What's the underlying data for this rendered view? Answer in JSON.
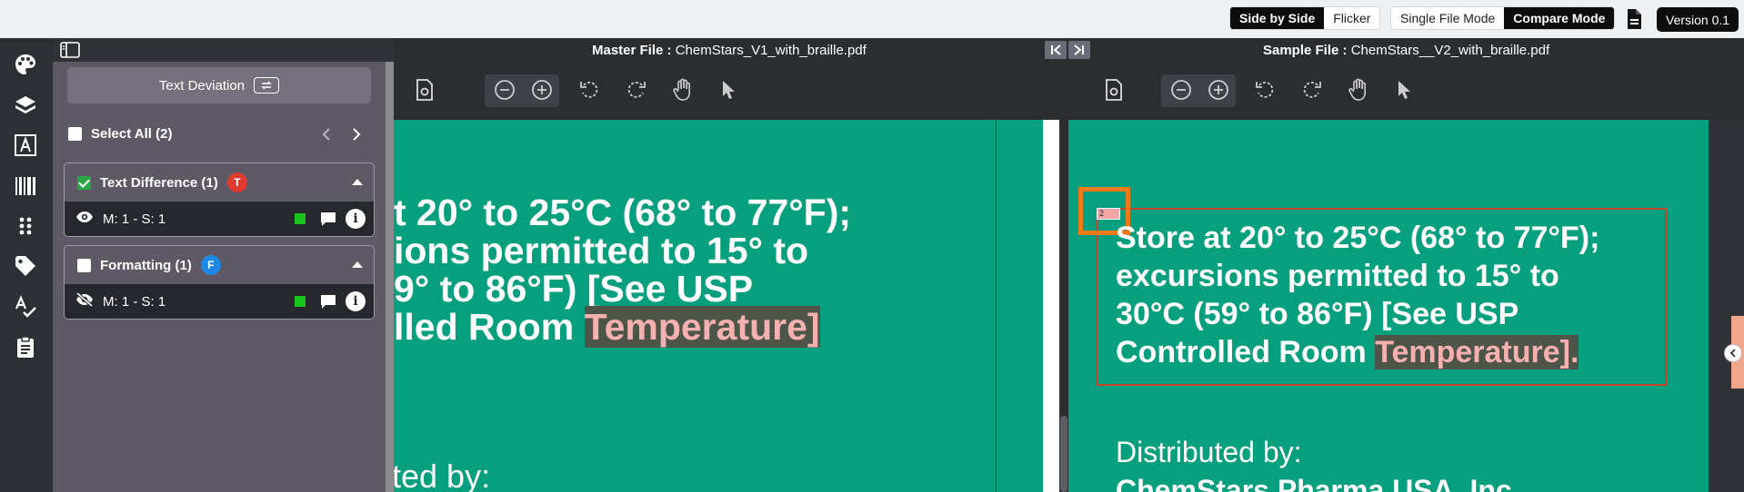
{
  "topbar": {
    "view_modes": [
      "Side by Side",
      "Flicker"
    ],
    "active_view_mode": "Side by Side",
    "file_modes": [
      "Single File Mode",
      "Compare Mode"
    ],
    "active_file_mode": "Compare Mode",
    "version": "Version 0.1"
  },
  "rail": {
    "icons": [
      "palette-icon",
      "layers-icon",
      "text-a-icon",
      "barcode-icon",
      "grid-dots-icon",
      "tag-icon",
      "spellcheck-icon",
      "clipboard-icon"
    ]
  },
  "panel": {
    "text_deviation_label": "Text Deviation",
    "select_all_label": "Select All (2)",
    "groups": [
      {
        "title": "Text Difference (1)",
        "checked": true,
        "badge": "T",
        "badge_color": "#e03a2f",
        "rows": [
          {
            "label": "M: 1 - S: 1",
            "visibility_icon": "eye-icon"
          }
        ]
      },
      {
        "title": "Formatting (1)",
        "checked": false,
        "badge": "F",
        "badge_color": "#1e88e5",
        "rows": [
          {
            "label": "M: 1 - S: 1",
            "visibility_icon": "eye-slash-icon"
          }
        ]
      }
    ]
  },
  "viewer": {
    "master_label": "Master File :",
    "master_file": "ChemStars_V1_with_braille.pdf",
    "sample_label": "Sample File :",
    "sample_file": "ChemStars__V2_with_braille.pdf"
  },
  "master_doc": {
    "lines": [
      "t 20° to 25°C (68° to 77°F);",
      "ions permitted to 15° to",
      "9° to 86°F) [See USP",
      "lled Room "
    ],
    "highlight": "Temperature]",
    "distributed": "ted by:"
  },
  "sample_doc": {
    "marker": "2",
    "lines": [
      "Store at 20° to 25°C (68° to 77°F);",
      "excursions permitted to 15° to",
      "30°C (59° to 86°F) [See USP",
      "Controlled Room "
    ],
    "highlight": "Temperature].",
    "distributed": "Distributed by:",
    "company": "ChemStars Pharma USA, Inc."
  },
  "colors": {
    "doc_background": "#07a07e",
    "highlight_text": "#f7b0b0",
    "selection_box": "#f07a1a"
  }
}
